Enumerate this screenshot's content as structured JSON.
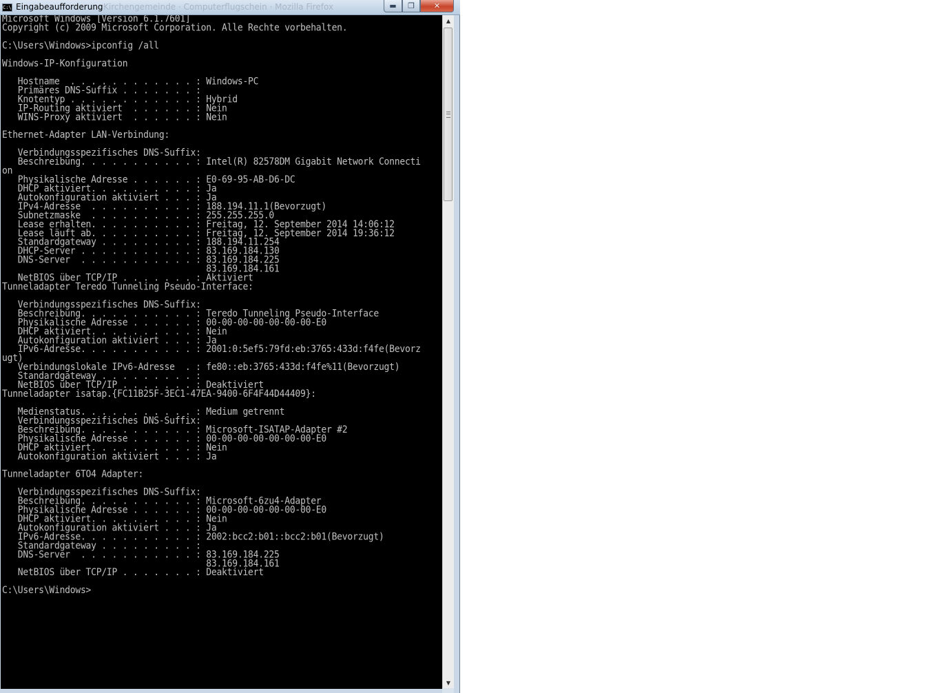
{
  "window": {
    "title": "Eingabeaufforderung",
    "background_title": "Kirchengemeinde · Computerflugschein · Mozilla Firefox",
    "icon": "cmd-icon",
    "buttons": {
      "minimize": "minimize-icon",
      "maximize": "maximize-icon",
      "close": "close-icon"
    }
  },
  "console": {
    "background": "#000000",
    "foreground": "#c0c0c0",
    "lines": [
      "Microsoft Windows [Version 6.1.7601]",
      "Copyright (c) 2009 Microsoft Corporation. Alle Rechte vorbehalten.",
      "",
      "C:\\Users\\Windows>ipconfig /all",
      "",
      "Windows-IP-Konfiguration",
      "",
      "   Hostname  . . . . . . . . . . . . : Windows-PC",
      "   Primäres DNS-Suffix . . . . . . . :",
      "   Knotentyp . . . . . . . . . . . . : Hybrid",
      "   IP-Routing aktiviert  . . . . . . : Nein",
      "   WINS-Proxy aktiviert  . . . . . . : Nein",
      "",
      "Ethernet-Adapter LAN-Verbindung:",
      "",
      "   Verbindungsspezifisches DNS-Suffix:",
      "   Beschreibung. . . . . . . . . . . : Intel(R) 82578DM Gigabit Network Connecti",
      "on",
      "   Physikalische Adresse . . . . . . : E0-69-95-AB-D6-DC",
      "   DHCP aktiviert. . . . . . . . . . : Ja",
      "   Autokonfiguration aktiviert . . . : Ja",
      "   IPv4-Adresse  . . . . . . . . . . : 188.194.11.1(Bevorzugt)",
      "   Subnetzmaske  . . . . . . . . . . : 255.255.255.0",
      "   Lease erhalten. . . . . . . . . . : Freitag, 12. September 2014 14:06:12",
      "   Lease läuft ab. . . . . . . . . . : Freitag, 12. September 2014 19:36:12",
      "   Standardgateway . . . . . . . . . : 188.194.11.254",
      "   DHCP-Server . . . . . . . . . . . : 83.169.184.130",
      "   DNS-Server  . . . . . . . . . . . : 83.169.184.225",
      "                                       83.169.184.161",
      "   NetBIOS über TCP/IP . . . . . . . : Aktiviert",
      "Tunneladapter Teredo Tunneling Pseudo-Interface:",
      "",
      "   Verbindungsspezifisches DNS-Suffix:",
      "   Beschreibung. . . . . . . . . . . : Teredo Tunneling Pseudo-Interface",
      "   Physikalische Adresse . . . . . . : 00-00-00-00-00-00-00-E0",
      "   DHCP aktiviert. . . . . . . . . . : Nein",
      "   Autokonfiguration aktiviert . . . : Ja",
      "   IPv6-Adresse. . . . . . . . . . . : 2001:0:5ef5:79fd:eb:3765:433d:f4fe(Bevorz",
      "ugt)",
      "   Verbindungslokale IPv6-Adresse  . : fe80::eb:3765:433d:f4fe%11(Bevorzugt)",
      "   Standardgateway . . . . . . . . . :",
      "   NetBIOS über TCP/IP . . . . . . . : Deaktiviert",
      "Tunneladapter isatap.{FC11B25F-3EC1-47EA-9400-6F4F44D44409}:",
      "",
      "   Medienstatus. . . . . . . . . . . : Medium getrennt",
      "   Verbindungsspezifisches DNS-Suffix:",
      "   Beschreibung. . . . . . . . . . . : Microsoft-ISATAP-Adapter #2",
      "   Physikalische Adresse . . . . . . : 00-00-00-00-00-00-00-E0",
      "   DHCP aktiviert. . . . . . . . . . : Nein",
      "   Autokonfiguration aktiviert . . . : Ja",
      "",
      "Tunneladapter 6TO4 Adapter:",
      "",
      "   Verbindungsspezifisches DNS-Suffix:",
      "   Beschreibung. . . . . . . . . . . : Microsoft-6zu4-Adapter",
      "   Physikalische Adresse . . . . . . : 00-00-00-00-00-00-00-E0",
      "   DHCP aktiviert. . . . . . . . . . : Nein",
      "   Autokonfiguration aktiviert . . . : Ja",
      "   IPv6-Adresse. . . . . . . . . . . : 2002:bcc2:b01::bcc2:b01(Bevorzugt)",
      "   Standardgateway . . . . . . . . . :",
      "   DNS-Server  . . . . . . . . . . . : 83.169.184.225",
      "                                       83.169.184.161",
      "   NetBIOS über TCP/IP . . . . . . . : Deaktiviert",
      "",
      "C:\\Users\\Windows>"
    ]
  },
  "scrollbar": {
    "up_icon": "scroll-up-arrow-icon",
    "down_icon": "scroll-down-arrow-icon"
  }
}
